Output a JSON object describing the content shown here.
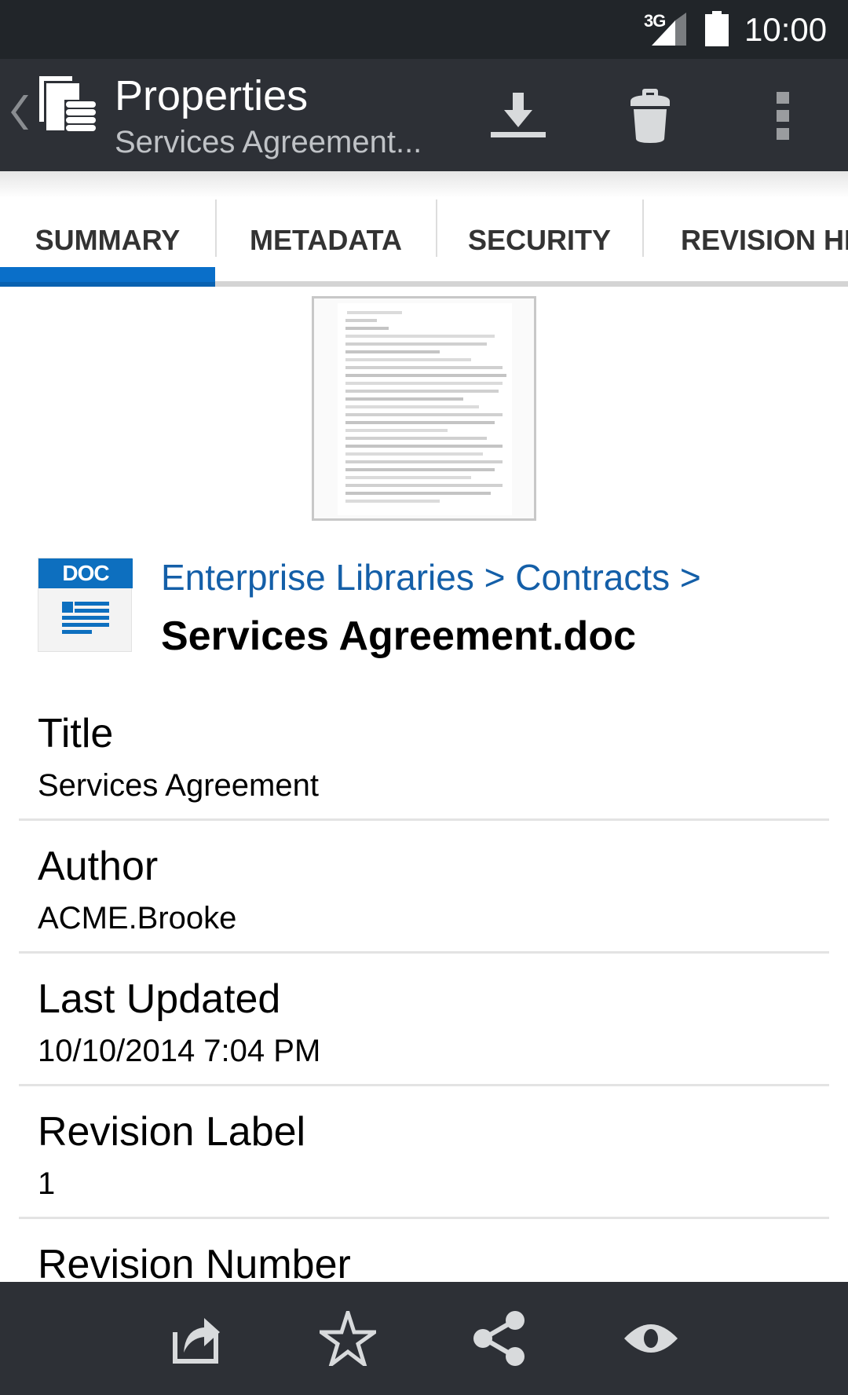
{
  "status_bar": {
    "network": "3G",
    "time": "10:00"
  },
  "app_bar": {
    "title": "Properties",
    "subtitle": "Services Agreement...",
    "actions": [
      {
        "name": "download",
        "icon": "download-icon"
      },
      {
        "name": "delete",
        "icon": "trash-icon"
      },
      {
        "name": "more",
        "icon": "overflow-menu-icon"
      }
    ]
  },
  "tabs": [
    {
      "label": "SUMMARY",
      "active": true
    },
    {
      "label": "METADATA",
      "active": false
    },
    {
      "label": "SECURITY",
      "active": false
    },
    {
      "label": "REVISION HISTORY",
      "active": false
    }
  ],
  "colors": {
    "accent": "#0a6fc9",
    "link": "#145fa8",
    "bar_bg": "#2d3036",
    "status_bg": "#212529"
  },
  "document": {
    "type_badge": "DOC",
    "breadcrumb": [
      "Enterprise Libraries",
      "Contracts"
    ],
    "breadcrumb_separator": ">",
    "filename": "Services Agreement.doc"
  },
  "properties": [
    {
      "label": "Title",
      "value": "Services Agreement"
    },
    {
      "label": "Author",
      "value": "ACME.Brooke"
    },
    {
      "label": "Last Updated",
      "value": "10/10/2014 7:04 PM"
    },
    {
      "label": "Revision Label",
      "value": "1"
    },
    {
      "label": "Revision Number",
      "value": ""
    }
  ],
  "bottom_bar": {
    "actions": [
      {
        "name": "open-in",
        "icon": "open-in-icon"
      },
      {
        "name": "favorite",
        "icon": "star-icon"
      },
      {
        "name": "share",
        "icon": "share-icon"
      },
      {
        "name": "view",
        "icon": "eye-icon"
      }
    ]
  }
}
